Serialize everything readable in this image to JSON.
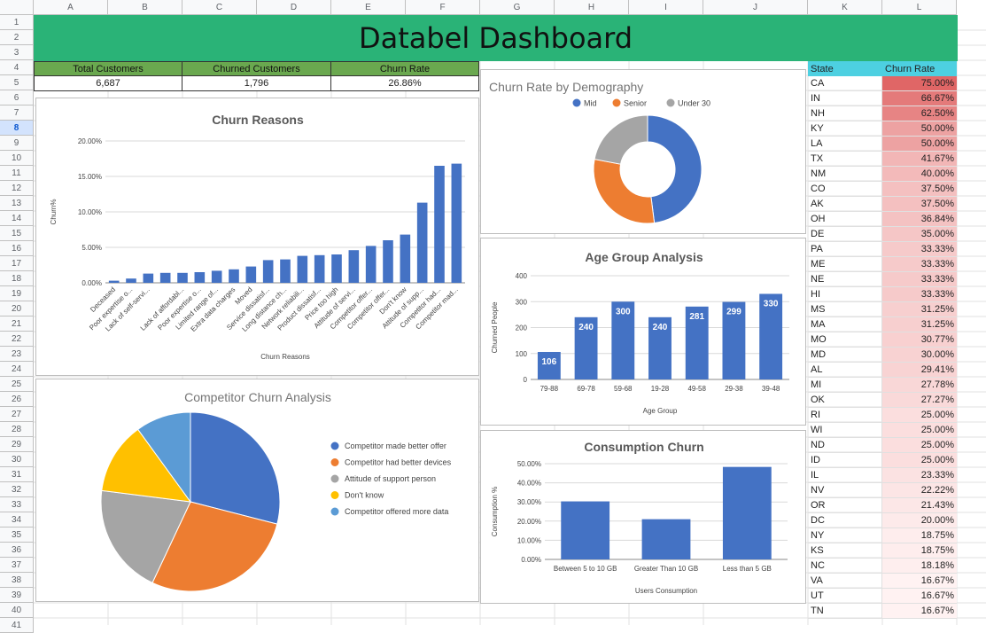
{
  "sheet": {
    "columns": [
      "A",
      "B",
      "C",
      "D",
      "E",
      "F",
      "G",
      "H",
      "I",
      "J",
      "K",
      "L"
    ],
    "rows": [
      "1",
      "2",
      "3",
      "4",
      "5",
      "6",
      "7",
      "8",
      "9",
      "10",
      "11",
      "12",
      "13",
      "14",
      "15",
      "16",
      "17",
      "18",
      "19",
      "20",
      "21",
      "22",
      "23",
      "24",
      "25",
      "26",
      "27",
      "28",
      "29",
      "30",
      "31",
      "32",
      "33",
      "34",
      "35",
      "36",
      "37",
      "38",
      "39",
      "40",
      "41"
    ],
    "selected_row": "8"
  },
  "title": "Databel Dashboard",
  "kpis": [
    {
      "label": "Total Customers",
      "value": "6,687"
    },
    {
      "label": "Churned Customers",
      "value": "1,796"
    },
    {
      "label": "Churn Rate",
      "value": "26.86%"
    }
  ],
  "state_table": {
    "header_state": "State",
    "header_rate": "Churn Rate",
    "heat_color": "#e06666",
    "rows": [
      {
        "state": "CA",
        "rate": "75.00%",
        "v": 75.0
      },
      {
        "state": "IN",
        "rate": "66.67%",
        "v": 66.67
      },
      {
        "state": "NH",
        "rate": "62.50%",
        "v": 62.5
      },
      {
        "state": "KY",
        "rate": "50.00%",
        "v": 50.0
      },
      {
        "state": "LA",
        "rate": "50.00%",
        "v": 50.0
      },
      {
        "state": "TX",
        "rate": "41.67%",
        "v": 41.67
      },
      {
        "state": "NM",
        "rate": "40.00%",
        "v": 40.0
      },
      {
        "state": "CO",
        "rate": "37.50%",
        "v": 37.5
      },
      {
        "state": "AK",
        "rate": "37.50%",
        "v": 37.5
      },
      {
        "state": "OH",
        "rate": "36.84%",
        "v": 36.84
      },
      {
        "state": "DE",
        "rate": "35.00%",
        "v": 35.0
      },
      {
        "state": "PA",
        "rate": "33.33%",
        "v": 33.33
      },
      {
        "state": "ME",
        "rate": "33.33%",
        "v": 33.33
      },
      {
        "state": "NE",
        "rate": "33.33%",
        "v": 33.33
      },
      {
        "state": "HI",
        "rate": "33.33%",
        "v": 33.33
      },
      {
        "state": "MS",
        "rate": "31.25%",
        "v": 31.25
      },
      {
        "state": "MA",
        "rate": "31.25%",
        "v": 31.25
      },
      {
        "state": "MO",
        "rate": "30.77%",
        "v": 30.77
      },
      {
        "state": "MD",
        "rate": "30.00%",
        "v": 30.0
      },
      {
        "state": "AL",
        "rate": "29.41%",
        "v": 29.41
      },
      {
        "state": "MI",
        "rate": "27.78%",
        "v": 27.78
      },
      {
        "state": "OK",
        "rate": "27.27%",
        "v": 27.27
      },
      {
        "state": "RI",
        "rate": "25.00%",
        "v": 25.0
      },
      {
        "state": "WI",
        "rate": "25.00%",
        "v": 25.0
      },
      {
        "state": "ND",
        "rate": "25.00%",
        "v": 25.0
      },
      {
        "state": "ID",
        "rate": "25.00%",
        "v": 25.0
      },
      {
        "state": "IL",
        "rate": "23.33%",
        "v": 23.33
      },
      {
        "state": "NV",
        "rate": "22.22%",
        "v": 22.22
      },
      {
        "state": "OR",
        "rate": "21.43%",
        "v": 21.43
      },
      {
        "state": "DC",
        "rate": "20.00%",
        "v": 20.0
      },
      {
        "state": "NY",
        "rate": "18.75%",
        "v": 18.75
      },
      {
        "state": "KS",
        "rate": "18.75%",
        "v": 18.75
      },
      {
        "state": "NC",
        "rate": "18.18%",
        "v": 18.18
      },
      {
        "state": "VA",
        "rate": "16.67%",
        "v": 16.67
      },
      {
        "state": "UT",
        "rate": "16.67%",
        "v": 16.67
      },
      {
        "state": "TN",
        "rate": "16.67%",
        "v": 16.67
      }
    ]
  },
  "chart_data": [
    {
      "id": "churn_reasons",
      "type": "bar",
      "title": "Churn Reasons",
      "xlabel": "Churn Reasons",
      "ylabel": "Churn%",
      "ylim": [
        0,
        20
      ],
      "yticks": [
        "0.00%",
        "5.00%",
        "10.00%",
        "15.00%",
        "20.00%"
      ],
      "color": "#4472c4",
      "categories": [
        "Deceased",
        "Poor expertise o...",
        "Lack of self-servi...",
        "",
        "Lack of affordabl...",
        "Poor expertise o...",
        "Limited range of...",
        "Extra data charges",
        "Moved",
        "Service dissatisf...",
        "Long distance ch...",
        "Network reliabili...",
        "Product dissatisf...",
        "Price too high",
        "Attitude of servi...",
        "Competitor offer...",
        "Competitor offer...",
        "Don't know",
        "Attitude of supp...",
        "Competitor had...",
        "Competitor mad..."
      ],
      "values": [
        0.3,
        0.6,
        1.3,
        1.4,
        1.4,
        1.5,
        1.7,
        1.9,
        2.3,
        3.2,
        3.3,
        3.8,
        3.9,
        4.0,
        4.6,
        5.2,
        6.0,
        6.8,
        11.3,
        16.5,
        16.8
      ]
    },
    {
      "id": "churn_by_demography",
      "type": "pie",
      "title": "Churn Rate by Demography",
      "labels": [
        "Mid",
        "Senior",
        "Under 30"
      ],
      "values": [
        48,
        30,
        22
      ],
      "colors": [
        "#4472c4",
        "#ed7d31",
        "#a5a5a5"
      ],
      "donut": true,
      "legend": "top"
    },
    {
      "id": "age_group",
      "type": "bar",
      "title": "Age Group Analysis",
      "xlabel": "Age Group",
      "ylabel": "Churned People",
      "ylim": [
        0,
        400
      ],
      "yticks": [
        "0",
        "100",
        "200",
        "300",
        "400"
      ],
      "color": "#4472c4",
      "categories": [
        "79-88",
        "69-78",
        "59-68",
        "19-28",
        "49-58",
        "29-38",
        "39-48"
      ],
      "values": [
        106,
        240,
        300,
        240,
        281,
        299,
        330
      ]
    },
    {
      "id": "competitor_churn",
      "type": "pie",
      "title": "Competitor Churn Analysis",
      "labels": [
        "Competitor made better offer",
        "Competitor had better devices",
        "Attitude of support person",
        "Don't know",
        "Competitor offered more data"
      ],
      "values": [
        29,
        28,
        20,
        13,
        10
      ],
      "colors": [
        "#4472c4",
        "#ed7d31",
        "#a5a5a5",
        "#ffc000",
        "#5b9bd5"
      ],
      "legend": "right"
    },
    {
      "id": "consumption_churn",
      "type": "bar",
      "title": "Consumption Churn",
      "xlabel": "Users Consumption",
      "ylabel": "Consumption %",
      "ylim": [
        0,
        50
      ],
      "yticks": [
        "0.00%",
        "10.00%",
        "20.00%",
        "30.00%",
        "40.00%",
        "50.00%"
      ],
      "color": "#4472c4",
      "categories": [
        "Between 5 to 10 GB",
        "Greater Than 10 GB",
        "Less than 5 GB"
      ],
      "values": [
        30.3,
        21.0,
        48.3
      ]
    }
  ]
}
